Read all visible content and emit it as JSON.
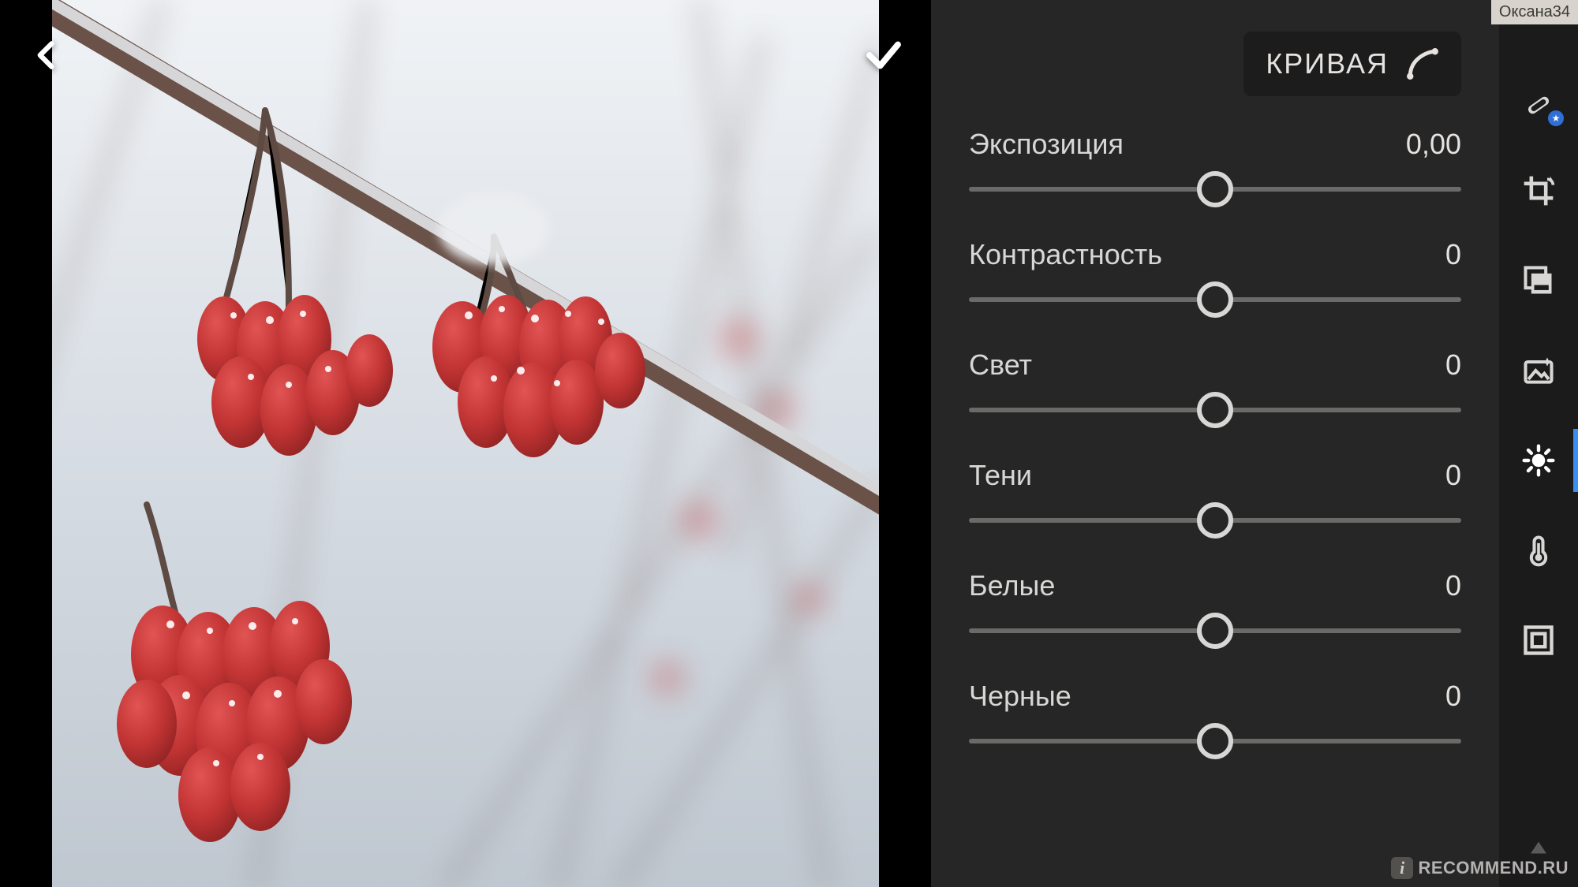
{
  "photo": {
    "user_tag": "Оксана34"
  },
  "panel": {
    "curve_label": "КРИВАЯ",
    "sliders": [
      {
        "label": "Экспозиция",
        "value": "0,00"
      },
      {
        "label": "Контрастность",
        "value": "0"
      },
      {
        "label": "Свет",
        "value": "0"
      },
      {
        "label": "Тени",
        "value": "0"
      },
      {
        "label": "Белые",
        "value": "0"
      },
      {
        "label": "Черные",
        "value": "0"
      }
    ]
  },
  "toolbar": {
    "items": [
      {
        "name": "healing-brush-icon",
        "active": false,
        "badge": true
      },
      {
        "name": "crop-icon",
        "active": false
      },
      {
        "name": "presets-icon",
        "active": false
      },
      {
        "name": "auto-photo-icon",
        "active": false
      },
      {
        "name": "light-icon",
        "active": true
      },
      {
        "name": "color-temp-icon",
        "active": false
      },
      {
        "name": "frame-fit-icon",
        "active": false
      }
    ]
  },
  "watermark": {
    "text": "RECOMMEND.RU"
  }
}
